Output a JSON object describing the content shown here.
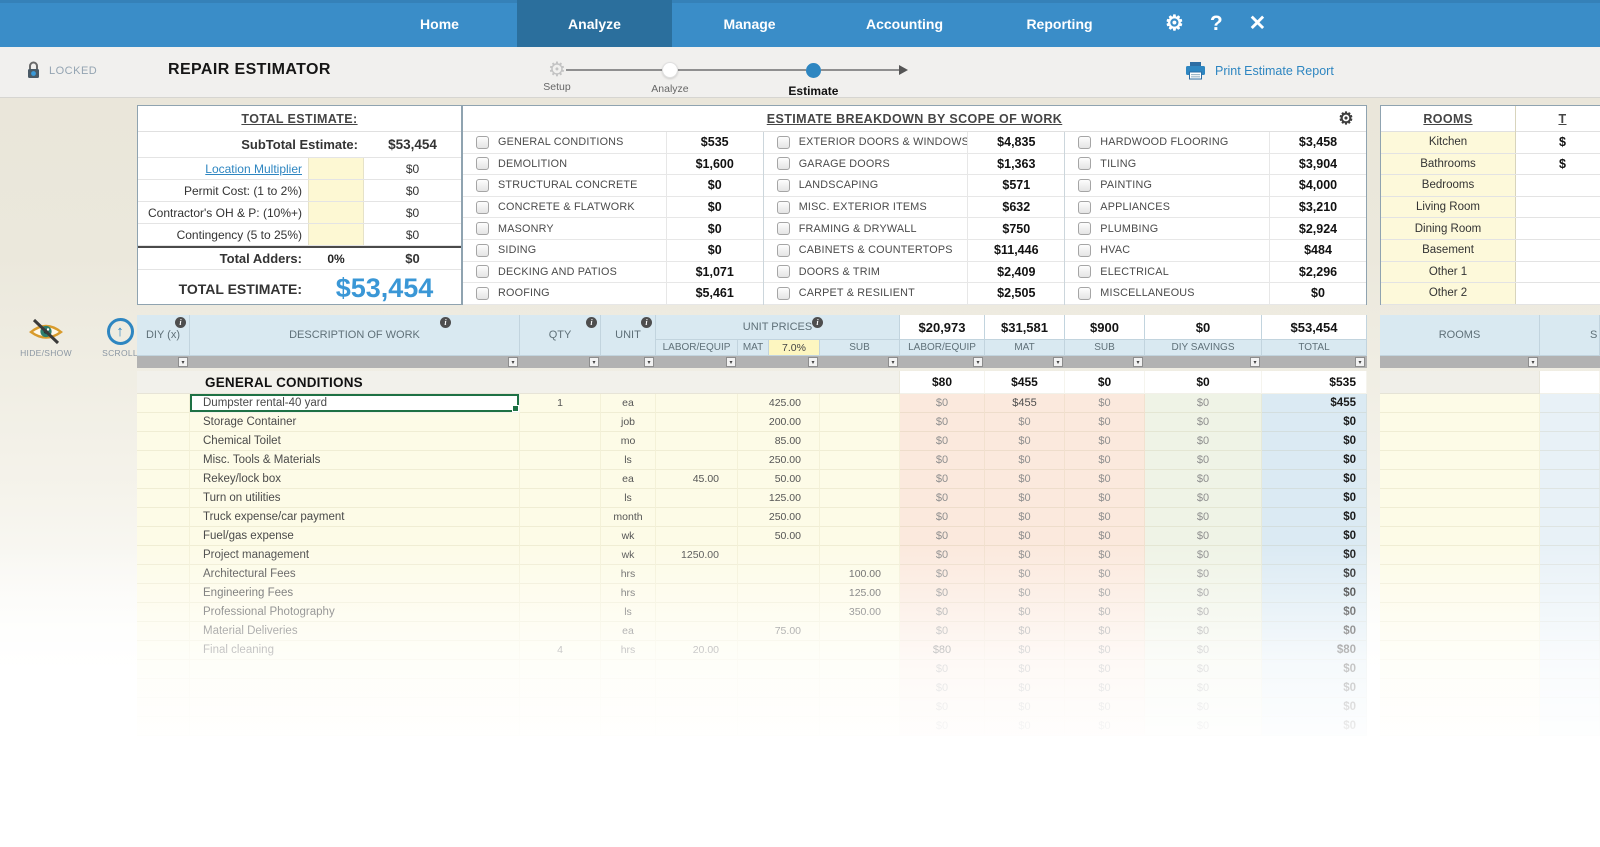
{
  "colors": {
    "nav_blue": "#3a8dc8",
    "nav_active_blue": "#2b6f9d",
    "accent_blue": "#2e86c1",
    "grand_total_blue": "#3a97d6",
    "input_yellow": "#fdf8d3",
    "header_blue": "#d9e9f1",
    "labor_mat_sub_bg": "#fbe9dd",
    "diy_savings_bg": "#eff3e6",
    "total_col_bg": "#dbeaf3",
    "selected_cell_border": "#1e7145"
  },
  "nav": {
    "tabs": [
      {
        "label": "Home",
        "active": false
      },
      {
        "label": "Analyze",
        "active": true
      },
      {
        "label": "Manage",
        "active": false
      },
      {
        "label": "Accounting",
        "active": false
      },
      {
        "label": "Reporting",
        "active": false
      }
    ],
    "gear_icon": "⚙",
    "help_icon": "?",
    "close_icon": "✕"
  },
  "header": {
    "locked_label": "LOCKED",
    "title": "REPAIR ESTIMATOR",
    "steps": [
      {
        "label": "Setup"
      },
      {
        "label": "Analyze"
      },
      {
        "label": "Estimate"
      }
    ],
    "print_label": "Print Estimate Report"
  },
  "totals_panel": {
    "title": "TOTAL ESTIMATE:",
    "subtotal_label": "SubTotal Estimate:",
    "subtotal_value": "$53,454",
    "adders": [
      {
        "label": "Location Multiplier",
        "value": "$0",
        "link": true
      },
      {
        "label": "Permit Cost: (1 to 2%)",
        "value": "$0",
        "link": false
      },
      {
        "label": "Contractor's  OH & P: (10%+)",
        "value": "$0",
        "link": false
      },
      {
        "label": "Contingency (5 to 25%)",
        "value": "$0",
        "link": false
      }
    ],
    "total_adders_label": "Total Adders:",
    "total_adders_pct": "0%",
    "total_adders_value": "$0",
    "total_label": "TOTAL ESTIMATE:",
    "total_value": "$53,454"
  },
  "breakdown": {
    "title": "ESTIMATE BREAKDOWN BY SCOPE OF WORK",
    "columns": [
      [
        {
          "label": "GENERAL CONDITIONS",
          "value": "$535"
        },
        {
          "label": "DEMOLITION",
          "value": "$1,600"
        },
        {
          "label": "STRUCTURAL CONCRETE",
          "value": "$0"
        },
        {
          "label": "CONCRETE & FLATWORK",
          "value": "$0"
        },
        {
          "label": "MASONRY",
          "value": "$0"
        },
        {
          "label": "SIDING",
          "value": "$0"
        },
        {
          "label": "DECKING AND PATIOS",
          "value": "$1,071"
        },
        {
          "label": "ROOFING",
          "value": "$5,461"
        }
      ],
      [
        {
          "label": "EXTERIOR DOORS & WINDOWS",
          "value": "$4,835"
        },
        {
          "label": "GARAGE DOORS",
          "value": "$1,363"
        },
        {
          "label": "LANDSCAPING",
          "value": "$571"
        },
        {
          "label": "MISC. EXTERIOR ITEMS",
          "value": "$632"
        },
        {
          "label": "FRAMING & DRYWALL",
          "value": "$750"
        },
        {
          "label": "CABINETS & COUNTERTOPS",
          "value": "$11,446"
        },
        {
          "label": "DOORS & TRIM",
          "value": "$2,409"
        },
        {
          "label": "CARPET & RESILIENT",
          "value": "$2,505"
        }
      ],
      [
        {
          "label": "HARDWOOD FLOORING",
          "value": "$3,458"
        },
        {
          "label": "TILING",
          "value": "$3,904"
        },
        {
          "label": "PAINTING",
          "value": "$4,000"
        },
        {
          "label": "APPLIANCES",
          "value": "$3,210"
        },
        {
          "label": "PLUMBING",
          "value": "$2,924"
        },
        {
          "label": "HVAC",
          "value": "$484"
        },
        {
          "label": "ELECTRICAL",
          "value": "$2,296"
        },
        {
          "label": "MISCELLANEOUS",
          "value": "$0"
        }
      ]
    ]
  },
  "rooms_panel": {
    "title": "ROOMS",
    "partial_col_header": "T",
    "rooms": [
      {
        "name": "Kitchen",
        "value": "$"
      },
      {
        "name": "Bathrooms",
        "value": "$"
      },
      {
        "name": "Bedrooms",
        "value": ""
      },
      {
        "name": "Living Room",
        "value": ""
      },
      {
        "name": "Dining Room",
        "value": ""
      },
      {
        "name": "Basement",
        "value": ""
      },
      {
        "name": "Other 1",
        "value": ""
      },
      {
        "name": "Other 2",
        "value": ""
      }
    ]
  },
  "side_tools": {
    "hide_show_label": "HIDE/SHOW",
    "scroll_label": "SCROLL"
  },
  "table": {
    "diy_header": "DIY (x)",
    "desc_header": "DESCRIPTION OF WORK",
    "qty_header": "QTY",
    "unit_header": "UNIT",
    "unit_prices_header": "UNIT PRICES",
    "sub_headers": {
      "labor": "LABOR/EQUIP",
      "mat": "MAT",
      "tax": "7.0%",
      "sub": "SUB"
    },
    "amount_totals": {
      "labor": "$20,973",
      "mat": "$31,581",
      "sub": "$900",
      "diy": "$0",
      "total": "$53,454"
    },
    "amount_headers": {
      "labor": "LABOR/EQUIP",
      "mat": "MAT",
      "sub": "SUB",
      "diy": "DIY SAVINGS",
      "total": "TOTAL"
    },
    "rooms_header": "ROOMS",
    "partial_header": "S",
    "section": {
      "name": "GENERAL CONDITIONS",
      "labor": "$80",
      "mat": "$455",
      "sub": "$0",
      "diy": "$0",
      "total": "$535"
    },
    "rows": [
      {
        "desc": "Dumpster rental-40 yard",
        "qty": "1",
        "unit": "ea",
        "labor": "",
        "mat": "425.00",
        "sub": "",
        "aLabor": "$0",
        "aMat": "$455",
        "aSub": "$0",
        "aDiy": "$0",
        "aTotal": "$455",
        "selected": true
      },
      {
        "desc": "Storage Container",
        "qty": "",
        "unit": "job",
        "labor": "",
        "mat": "200.00",
        "sub": "",
        "aLabor": "$0",
        "aMat": "$0",
        "aSub": "$0",
        "aDiy": "$0",
        "aTotal": "$0",
        "selected": false
      },
      {
        "desc": "Chemical Toilet",
        "qty": "",
        "unit": "mo",
        "labor": "",
        "mat": "85.00",
        "sub": "",
        "aLabor": "$0",
        "aMat": "$0",
        "aSub": "$0",
        "aDiy": "$0",
        "aTotal": "$0",
        "selected": false
      },
      {
        "desc": "Misc. Tools & Materials",
        "qty": "",
        "unit": "ls",
        "labor": "",
        "mat": "250.00",
        "sub": "",
        "aLabor": "$0",
        "aMat": "$0",
        "aSub": "$0",
        "aDiy": "$0",
        "aTotal": "$0",
        "selected": false
      },
      {
        "desc": "Rekey/lock box",
        "qty": "",
        "unit": "ea",
        "labor": "45.00",
        "mat": "50.00",
        "sub": "",
        "aLabor": "$0",
        "aMat": "$0",
        "aSub": "$0",
        "aDiy": "$0",
        "aTotal": "$0",
        "selected": false
      },
      {
        "desc": "Turn on utilities",
        "qty": "",
        "unit": "ls",
        "labor": "",
        "mat": "125.00",
        "sub": "",
        "aLabor": "$0",
        "aMat": "$0",
        "aSub": "$0",
        "aDiy": "$0",
        "aTotal": "$0",
        "selected": false
      },
      {
        "desc": "Truck expense/car payment",
        "qty": "",
        "unit": "month",
        "labor": "",
        "mat": "250.00",
        "sub": "",
        "aLabor": "$0",
        "aMat": "$0",
        "aSub": "$0",
        "aDiy": "$0",
        "aTotal": "$0",
        "selected": false
      },
      {
        "desc": "Fuel/gas expense",
        "qty": "",
        "unit": "wk",
        "labor": "",
        "mat": "50.00",
        "sub": "",
        "aLabor": "$0",
        "aMat": "$0",
        "aSub": "$0",
        "aDiy": "$0",
        "aTotal": "$0",
        "selected": false
      },
      {
        "desc": "Project management",
        "qty": "",
        "unit": "wk",
        "labor": "1250.00",
        "mat": "",
        "sub": "",
        "aLabor": "$0",
        "aMat": "$0",
        "aSub": "$0",
        "aDiy": "$0",
        "aTotal": "$0",
        "selected": false
      },
      {
        "desc": "Architectural Fees",
        "qty": "",
        "unit": "hrs",
        "labor": "",
        "mat": "",
        "sub": "100.00",
        "aLabor": "$0",
        "aMat": "$0",
        "aSub": "$0",
        "aDiy": "$0",
        "aTotal": "$0",
        "selected": false
      },
      {
        "desc": "Engineering Fees",
        "qty": "",
        "unit": "hrs",
        "labor": "",
        "mat": "",
        "sub": "125.00",
        "aLabor": "$0",
        "aMat": "$0",
        "aSub": "$0",
        "aDiy": "$0",
        "aTotal": "$0",
        "selected": false
      },
      {
        "desc": "Professional Photography",
        "qty": "",
        "unit": "ls",
        "labor": "",
        "mat": "",
        "sub": "350.00",
        "aLabor": "$0",
        "aMat": "$0",
        "aSub": "$0",
        "aDiy": "$0",
        "aTotal": "$0",
        "selected": false
      },
      {
        "desc": "Material Deliveries",
        "qty": "",
        "unit": "ea",
        "labor": "",
        "mat": "75.00",
        "sub": "",
        "aLabor": "$0",
        "aMat": "$0",
        "aSub": "$0",
        "aDiy": "$0",
        "aTotal": "$0",
        "selected": false
      },
      {
        "desc": "Final cleaning",
        "qty": "4",
        "unit": "hrs",
        "labor": "20.00",
        "mat": "",
        "sub": "",
        "aLabor": "$80",
        "aMat": "$0",
        "aSub": "$0",
        "aDiy": "$0",
        "aTotal": "$80",
        "selected": false
      }
    ],
    "empty_rows": 4,
    "empty_amount": "$0"
  }
}
